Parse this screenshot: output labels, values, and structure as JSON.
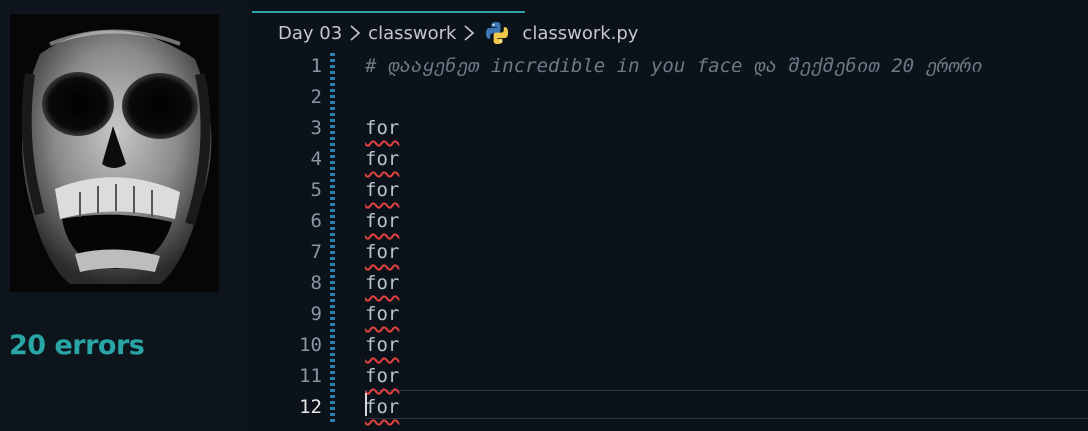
{
  "sidebar": {
    "image_alt": "screaming skull",
    "errors_label": "20 errors"
  },
  "breadcrumb": {
    "folder1": "Day 03",
    "folder2": "classwork",
    "file": "classwork.py"
  },
  "editor": {
    "lines": [
      {
        "num": "1",
        "text": "# დააყენეთ incredible in you face და შექმენით 20 ერორი"
      },
      {
        "num": "2",
        "text": ""
      },
      {
        "num": "3",
        "text": "for"
      },
      {
        "num": "4",
        "text": "for"
      },
      {
        "num": "5",
        "text": "for"
      },
      {
        "num": "6",
        "text": "for"
      },
      {
        "num": "7",
        "text": "for"
      },
      {
        "num": "8",
        "text": "for"
      },
      {
        "num": "9",
        "text": "for"
      },
      {
        "num": "10",
        "text": "for"
      },
      {
        "num": "11",
        "text": "for"
      },
      {
        "num": "12",
        "text": "for"
      }
    ]
  },
  "colors": {
    "accent": "#2aa5a5",
    "error_squiggle": "#e0413d",
    "background": "#0b121a"
  },
  "icons": {
    "file_type": "python-icon",
    "separator": "chevron-right-icon"
  }
}
